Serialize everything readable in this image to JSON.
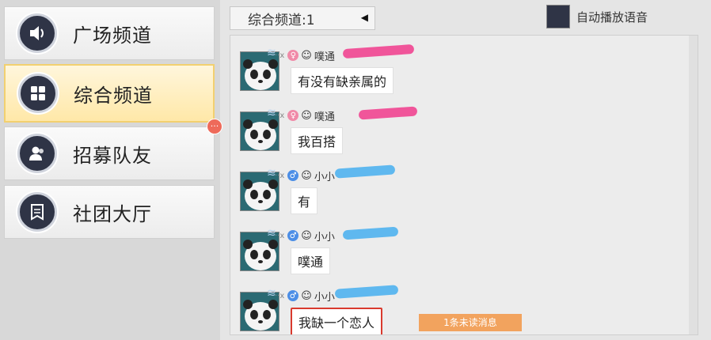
{
  "sidebar": {
    "items": [
      {
        "label": "广场频道",
        "icon": "speaker-icon",
        "active": false
      },
      {
        "label": "综合频道",
        "icon": "grid-icon",
        "active": true
      },
      {
        "label": "招募队友",
        "icon": "users-icon",
        "active": false
      },
      {
        "label": "社团大厅",
        "icon": "banner-icon",
        "active": false
      }
    ],
    "notice_badge": "···"
  },
  "header": {
    "channel": "综合频道:1",
    "auto_play_label": "自动播放语音"
  },
  "chat": {
    "messages": [
      {
        "name": "噗通",
        "gender": "female",
        "text": "有没有缺亲属的",
        "highlighted": false
      },
      {
        "name": "噗通",
        "gender": "female",
        "text": "我百搭",
        "highlighted": false
      },
      {
        "name": "小小",
        "gender": "male",
        "text": "有",
        "highlighted": false
      },
      {
        "name": "小小",
        "gender": "male",
        "text": "噗通",
        "highlighted": false
      },
      {
        "name": "小小",
        "gender": "male",
        "text": "我缺一个恋人",
        "highlighted": true
      }
    ],
    "unread_notice": "1条未读消息"
  },
  "colors": {
    "active_border": "#f2d070",
    "highlight_border": "#d93a2e",
    "unread_bg": "#f2a35e",
    "icon_bg": "#2f3446"
  }
}
